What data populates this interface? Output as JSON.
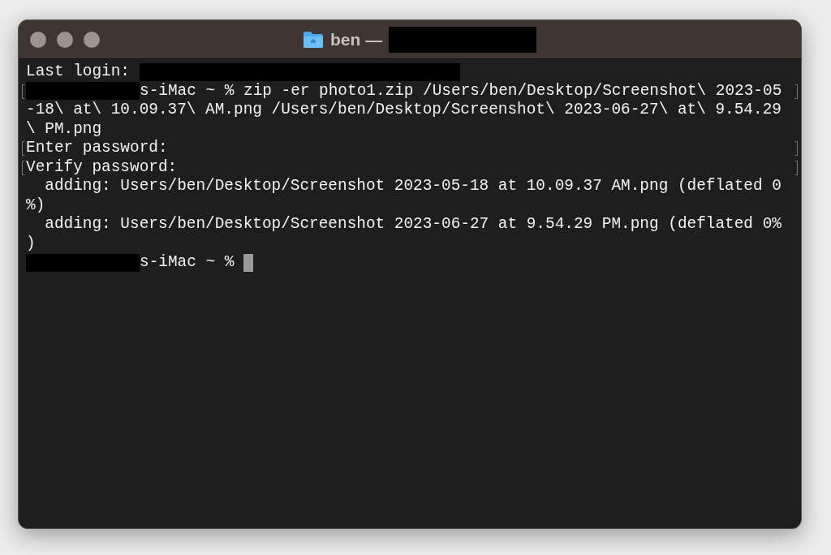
{
  "window": {
    "title": "ben —"
  },
  "terminal": {
    "lines": [
      {
        "marked": false,
        "segments": [
          {
            "kind": "text",
            "text": "Last login: "
          },
          {
            "kind": "redacted"
          }
        ]
      },
      {
        "marked": true,
        "segments": [
          {
            "kind": "redacted"
          },
          {
            "kind": "text",
            "text": "s-iMac ~ % zip -er photo1.zip /Users/ben/Desktop/Screenshot\\ 2023-05"
          }
        ]
      },
      {
        "marked": false,
        "segments": [
          {
            "kind": "text",
            "text": "-18\\ at\\ 10.09.37\\ AM.png /Users/ben/Desktop/Screenshot\\ 2023-06-27\\ at\\ 9.54.29"
          }
        ]
      },
      {
        "marked": false,
        "segments": [
          {
            "kind": "text",
            "text": "\\ PM.png"
          }
        ]
      },
      {
        "marked": true,
        "segments": [
          {
            "kind": "text",
            "text": "Enter password:"
          }
        ]
      },
      {
        "marked": true,
        "segments": [
          {
            "kind": "text",
            "text": "Verify password:"
          }
        ]
      },
      {
        "marked": false,
        "segments": [
          {
            "kind": "text",
            "text": "  adding: Users/ben/Desktop/Screenshot 2023-05-18 at 10.09.37 AM.png (deflated 0"
          }
        ]
      },
      {
        "marked": false,
        "segments": [
          {
            "kind": "text",
            "text": "%)"
          }
        ]
      },
      {
        "marked": false,
        "segments": [
          {
            "kind": "text",
            "text": "  adding: Users/ben/Desktop/Screenshot 2023-06-27 at 9.54.29 PM.png (deflated 0%"
          }
        ]
      },
      {
        "marked": false,
        "segments": [
          {
            "kind": "text",
            "text": ")"
          }
        ]
      },
      {
        "marked": false,
        "segments": [
          {
            "kind": "redacted"
          },
          {
            "kind": "text",
            "text": "s-iMac ~ % "
          },
          {
            "kind": "cursor"
          }
        ]
      }
    ]
  }
}
